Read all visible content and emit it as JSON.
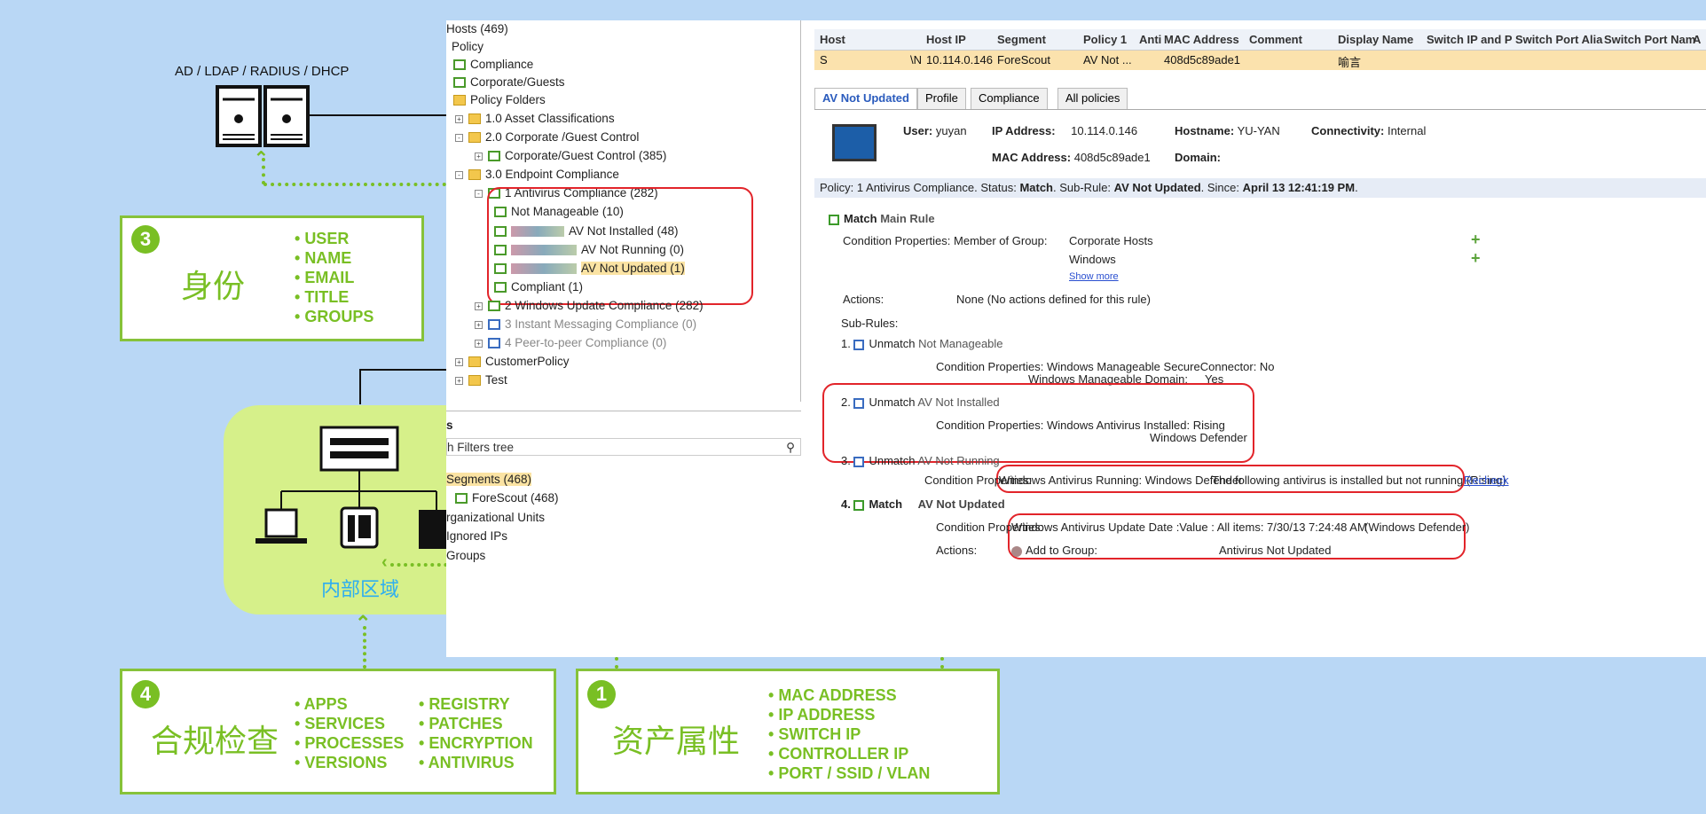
{
  "left": {
    "ad_label": "AD / LDAP / RADIUS / DHCP",
    "internal_zone": "内部区域"
  },
  "box3": {
    "num": "3",
    "title": "身份",
    "items": [
      "USER",
      "NAME",
      "EMAIL",
      "TITLE",
      "GROUPS"
    ]
  },
  "box4": {
    "num": "4",
    "title": "合规检查",
    "col1": [
      "APPS",
      "SERVICES",
      "PROCESSES",
      "VERSIONS"
    ],
    "col2": [
      "REGISTRY",
      "PATCHES",
      "ENCRYPTION",
      "ANTIVIRUS"
    ]
  },
  "box1": {
    "num": "1",
    "title": "资产属性",
    "items": [
      "MAC ADDRESS",
      "IP ADDRESS",
      "SWITCH IP",
      "CONTROLLER IP",
      "PORT / SSID / VLAN"
    ]
  },
  "tree": {
    "items": [
      "Hosts (469)",
      "Policy",
      "Compliance",
      "Corporate/Guests",
      "Policy Folders",
      "1.0 Asset Classifications",
      "2.0 Corporate /Guest Control",
      "Corporate/Guest Control (385)",
      "3.0 Endpoint Compliance",
      "1  Antivirus Compliance (282)",
      "Not Manageable (10)",
      "AV Not Installed (48)",
      "AV Not Running (0)",
      "AV Not Updated (1)",
      "Compliant (1)",
      "2  Windows Update Compliance (282)",
      "3  Instant Messaging Compliance (0)",
      "4  Peer-to-peer Compliance (0)",
      "CustomerPolicy",
      "Test"
    ]
  },
  "filters": {
    "header": "s",
    "search_placeholder": "h Filters tree",
    "items": [
      "Segments (468)",
      "ForeScout (468)",
      "rganizational Units",
      "Ignored IPs",
      "Groups"
    ]
  },
  "table": {
    "headers": [
      "Host",
      "Host IP",
      "Segment",
      "Policy 1",
      "Anti",
      "MAC Address",
      "Comment",
      "Display Name",
      "Switch IP and P",
      "Switch Port Alia",
      "Switch Port Nam",
      "A"
    ],
    "row": {
      "host": "S",
      "host_tail": "\\N",
      "ip": "10.114.0.146",
      "segment": "ForeScout",
      "policy": "AV Not ...",
      "mac": "408d5c89ade1",
      "display": "喻言"
    }
  },
  "tabs": [
    "AV Not Updated",
    "Profile",
    "Compliance",
    "All policies"
  ],
  "info": {
    "user_l": "User:",
    "user_v": "yuyan",
    "ip_l": "IP Address:",
    "ip_v": "10.114.0.146",
    "host_l": "Hostname:",
    "host_v": "YU-YAN",
    "conn_l": "Connectivity:",
    "conn_v": "Internal",
    "mac_l": "MAC Address:",
    "mac_v": "408d5c89ade1",
    "dom_l": "Domain:"
  },
  "status": {
    "a": "Policy: 1 Antivirus Compliance. Status: ",
    "b": "Match",
    "c": ". Sub-Rule: ",
    "d": "AV Not Updated",
    "e": ". Since: ",
    "f": "April 13 12:41:19 PM",
    "g": "."
  },
  "main": {
    "match": "Match",
    "rule": "Main Rule",
    "cond_l": "Condition Properties: Member of Group:",
    "g1": "Corporate Hosts",
    "g2": "Windows",
    "more": "Show more",
    "act_l": "Actions:",
    "act_v": "None (No actions defined for this rule)",
    "subrules": "Sub-Rules:"
  },
  "s1": {
    "n": "1.",
    "m": "Unmatch",
    "name": "Not Manageable",
    "cond": "Condition Properties: Windows Manageable SecureConnector: No",
    "cond2a": "Windows Manageable Domain:",
    "cond2b": "Yes"
  },
  "s2": {
    "n": "2.",
    "m": "Unmatch",
    "name": "AV Not Installed",
    "cond": "Condition Properties: Windows Antivirus Installed: Rising",
    "cond2": "Windows Defender"
  },
  "s3": {
    "n": "3.",
    "m": "Unmatch",
    "name": "AV Not Running",
    "cond_l": "Condition Properties:",
    "cond_v": "Windows Antivirus Running: Windows Defender",
    "note": "The following antivirus is installed but not running (Rising)",
    "recheck": "Recheck"
  },
  "s4": {
    "n": "4.",
    "m": "Match",
    "name": "AV Not Updated",
    "cond_l": "Condition Properties:",
    "cond_v": "Windows Antivirus Update Date :Value : All items: 7/30/13 7:24:48 AM",
    "cond_w": "(Windows Defender)",
    "act_l": "Actions:",
    "act_v": "Add to Group:",
    "act_g": "Antivirus Not Updated"
  }
}
